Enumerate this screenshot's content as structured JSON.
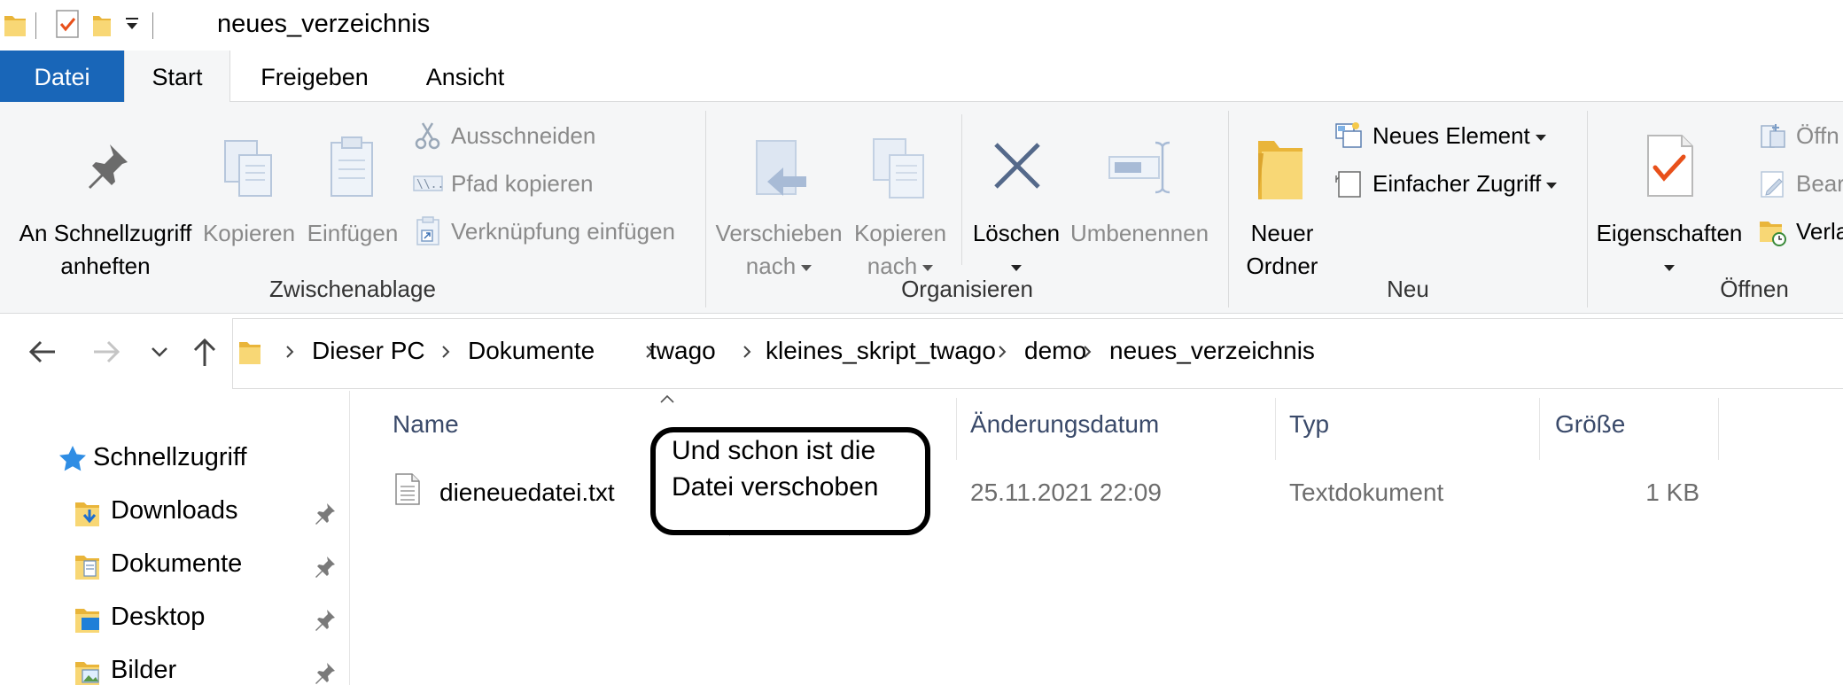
{
  "window": {
    "title": "neues_verzeichnis"
  },
  "ribbon_tabs": [
    {
      "label": "Datei"
    },
    {
      "label": "Start"
    },
    {
      "label": "Freigeben"
    },
    {
      "label": "Ansicht"
    }
  ],
  "ribbon": {
    "clipboard": {
      "pin_line1": "An Schnellzugriff",
      "pin_line2": "anheften",
      "copy": "Kopieren",
      "paste": "Einfügen",
      "cut": "Ausschneiden",
      "copy_path": "Pfad kopieren",
      "paste_shortcut": "Verknüpfung einfügen",
      "group_label": "Zwischenablage"
    },
    "organize": {
      "move_line1": "Verschieben",
      "move_line2": "nach",
      "copy_line1": "Kopieren",
      "copy_line2": "nach",
      "delete": "Löschen",
      "rename": "Umbenennen",
      "group_label": "Organisieren"
    },
    "new": {
      "folder_line1": "Neuer",
      "folder_line2": "Ordner",
      "new_item": "Neues Element",
      "easy_access": "Einfacher Zugriff",
      "group_label": "Neu"
    },
    "open": {
      "properties": "Eigenschaften",
      "open_small": "Öffn",
      "edit_small": "Bear",
      "history_small": "Verla",
      "group_label": "Öffnen"
    }
  },
  "address_bar": {
    "breadcrumbs": [
      "Dieser PC",
      "Dokumente",
      "twago",
      "kleines_skript_twago",
      "demo",
      "neues_verzeichnis"
    ]
  },
  "nav_pane": {
    "quick_access": "Schnellzugriff",
    "items": [
      {
        "label": "Downloads"
      },
      {
        "label": "Dokumente"
      },
      {
        "label": "Desktop"
      },
      {
        "label": "Bilder"
      }
    ]
  },
  "file_list": {
    "columns": [
      "Name",
      "Änderungsdatum",
      "Typ",
      "Größe"
    ],
    "rows": [
      {
        "name": "dieneuedatei.txt",
        "date": "25.11.2021 22:09",
        "type": "Textdokument",
        "size": "1 KB"
      }
    ]
  },
  "annotation": {
    "text": "Und schon ist die\nDatei verschoben"
  },
  "colors": {
    "file_tab": "#1966b8",
    "ribbon_bg": "#f5f6f7",
    "accent_check": "#e8501a",
    "folder_yellow": "#f5c94a"
  }
}
